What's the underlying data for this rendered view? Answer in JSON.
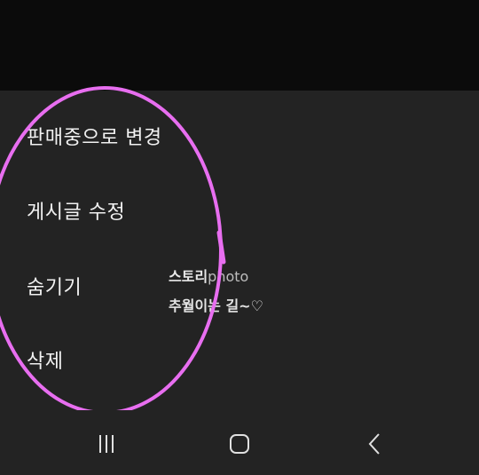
{
  "menu": {
    "items": [
      {
        "label": "판매중으로 변경"
      },
      {
        "label": "게시글 수정"
      },
      {
        "label": "숨기기"
      },
      {
        "label": "삭제"
      }
    ]
  },
  "watermark": {
    "brand_bold": "스토리",
    "brand_suffix": "photo",
    "tagline": "추월이는 길~♡"
  },
  "navbar": {
    "recent_icon": "recent-apps-icon",
    "home_icon": "home-icon",
    "back_icon": "back-icon"
  },
  "colors": {
    "background": "#232323",
    "top_overlay": "#0b0b0b",
    "menu_text": "#f2f2f2",
    "annotation_circle": "#e86ef0"
  }
}
